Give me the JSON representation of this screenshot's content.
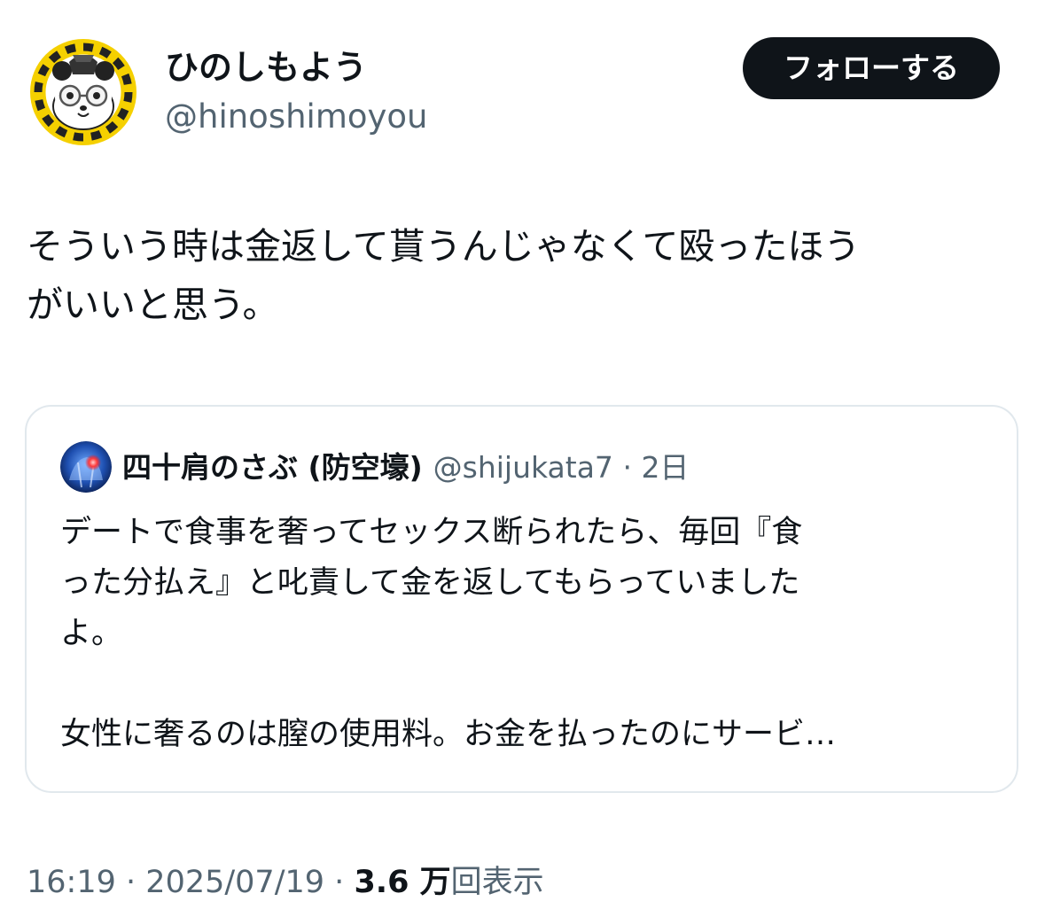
{
  "author": {
    "display_name": "ひのしもよう",
    "handle": "@hinoshimoyou",
    "avatar_icon": "panda-glasses-avatar-icon"
  },
  "follow_button": {
    "label": "フォローする"
  },
  "tweet": {
    "lines": [
      "そういう時は金返して貰うんじゃなくて殴ったほう",
      "がいいと思う。"
    ]
  },
  "quote": {
    "avatar_icon": "shoulder-xray-avatar-icon",
    "display_name": "四十肩のさぶ (防空壕)",
    "handle": "@shijukata7",
    "separator": "·",
    "time": "2日",
    "lines": [
      "デートで食事を奢ってセックス断られたら、毎回『食",
      "った分払え』と叱責して金を返してもらっていました",
      "よ。",
      "",
      "女性に奢るのは膣の使用料。お金を払ったのにサービ…"
    ]
  },
  "meta": {
    "time": "16:19",
    "separator": "·",
    "date": "2025/07/19",
    "views_count": "3.6 万",
    "views_label": "回表示"
  },
  "colors": {
    "text": "#0f1419",
    "secondary": "#536471",
    "border": "#e1e8ed",
    "button_bg": "#0f1419",
    "avatar_ring": "#f5d000"
  }
}
